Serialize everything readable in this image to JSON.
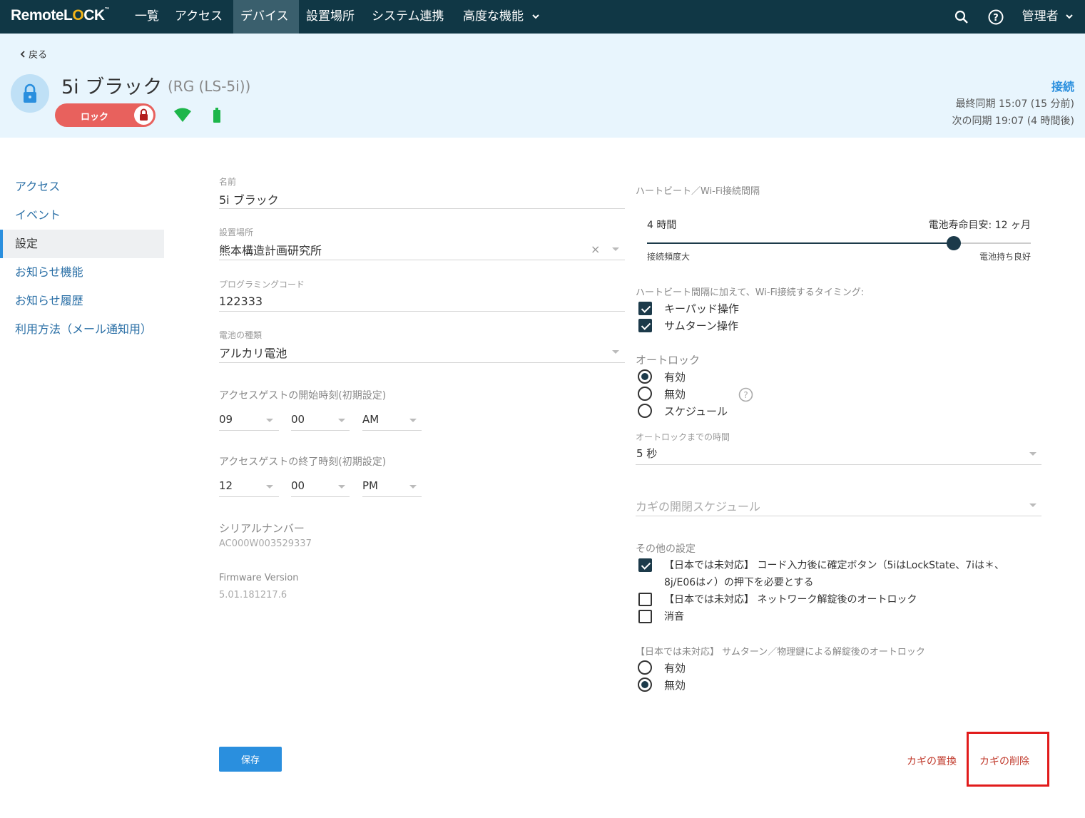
{
  "nav": {
    "logo_pre": "Remote",
    "logo_o": "L",
    "logo_mid": "O",
    "logo_post": "CK",
    "items": [
      "一覧",
      "アクセス",
      "デバイス",
      "設置場所",
      "システム連携",
      "高度な機能"
    ],
    "active": "デバイス",
    "admin": "管理者"
  },
  "header": {
    "back": "戻る",
    "device_name": "5i ブラック",
    "device_model": "(RG (LS-5i))",
    "lock_label": "ロック",
    "connection": "接続",
    "last_sync": "最終同期  15:07 (15 分前)",
    "next_sync": "次の同期  19:07 (4 時間後)"
  },
  "sidebar": {
    "items": [
      "アクセス",
      "イベント",
      "設定",
      "お知らせ機能",
      "お知らせ履歴",
      "利用方法（メール通知用）"
    ]
  },
  "form": {
    "name_label": "名前",
    "name_value": "5i ブラック",
    "location_label": "設置場所",
    "location_value": "熊本構造計画研究所",
    "code_label": "プログラミングコード",
    "code_value": "122333",
    "battery_label": "電池の種類",
    "battery_value": "アルカリ電池",
    "start_label": "アクセスゲストの開始時刻(初期設定)",
    "start_h": "09",
    "start_m": "00",
    "start_ap": "AM",
    "end_label": "アクセスゲストの終了時刻(初期設定)",
    "end_h": "12",
    "end_m": "00",
    "end_ap": "PM",
    "serial_label": "シリアルナンバー",
    "serial_value": "AC000W003529337",
    "fw_label": "Firmware Version",
    "fw_value": "5.01.181217.6"
  },
  "right": {
    "hb_label": "ハートビート／Wi-Fi接続間隔",
    "hb_value": "4 時間",
    "battery_life": "電池寿命目安: 12 ヶ月",
    "slider_left": "接続頻度大",
    "slider_right": "電池持ち良好",
    "slider_fraction": 0.8,
    "timing_label": "ハートビート間隔に加えて、Wi-Fi接続するタイミング:",
    "keypad": "キーパッド操作",
    "thumbturn": "サムターン操作",
    "autolock_label": "オートロック",
    "al_on": "有効",
    "al_off": "無効",
    "al_sched": "スケジュール",
    "al_time_label": "オートロックまでの時間",
    "al_time_value": "5 秒",
    "schedule_placeholder": "カギの開閉スケジュール",
    "other_label": "その他の設定",
    "other1_line1": "【日本では未対応】 コード入力後に確定ボタン（5iはLockState、7iは＊、",
    "other1_line2": "8j/E06は✓）の押下を必要とする",
    "other2": "【日本では未対応】 ネットワーク解錠後のオートロック",
    "other3": "消音",
    "manual_label": "【日本では未対応】 サムターン／物理鍵による解錠後のオートロック",
    "manual_on": "有効",
    "manual_off": "無効"
  },
  "footer": {
    "save": "保存",
    "replace": "カギの置換",
    "delete": "カギの削除"
  },
  "colors": {
    "nav": "#103745",
    "band": "#e8f5fd",
    "accent": "#2a8fde",
    "lock": "#e8615d",
    "danger": "#c0392b"
  }
}
